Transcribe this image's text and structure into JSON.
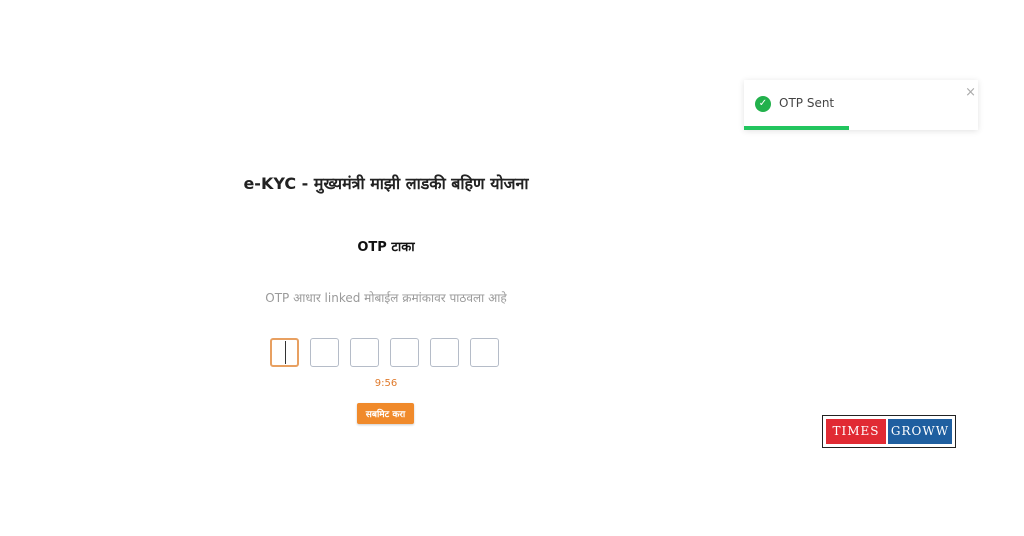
{
  "toast": {
    "message": "OTP Sent",
    "close_glyph": "×",
    "status_icon": "check-circle-icon",
    "progress": 0.45,
    "color": "#22c55e"
  },
  "form": {
    "title": "e-KYC - मुख्यमंत्री माझी लाडकी बहिण योजना",
    "heading": "OTP टाका",
    "description": "OTP आधार linked मोबाईल क्रमांकावर पाठवला आहे",
    "otp_digits": [
      "",
      "",
      "",
      "",
      "",
      ""
    ],
    "timer": "9:56",
    "submit_label": "सबमिट करा",
    "accent_color": "#f08a2b"
  },
  "watermark": {
    "left": "TIMES",
    "right": "GROWW"
  }
}
